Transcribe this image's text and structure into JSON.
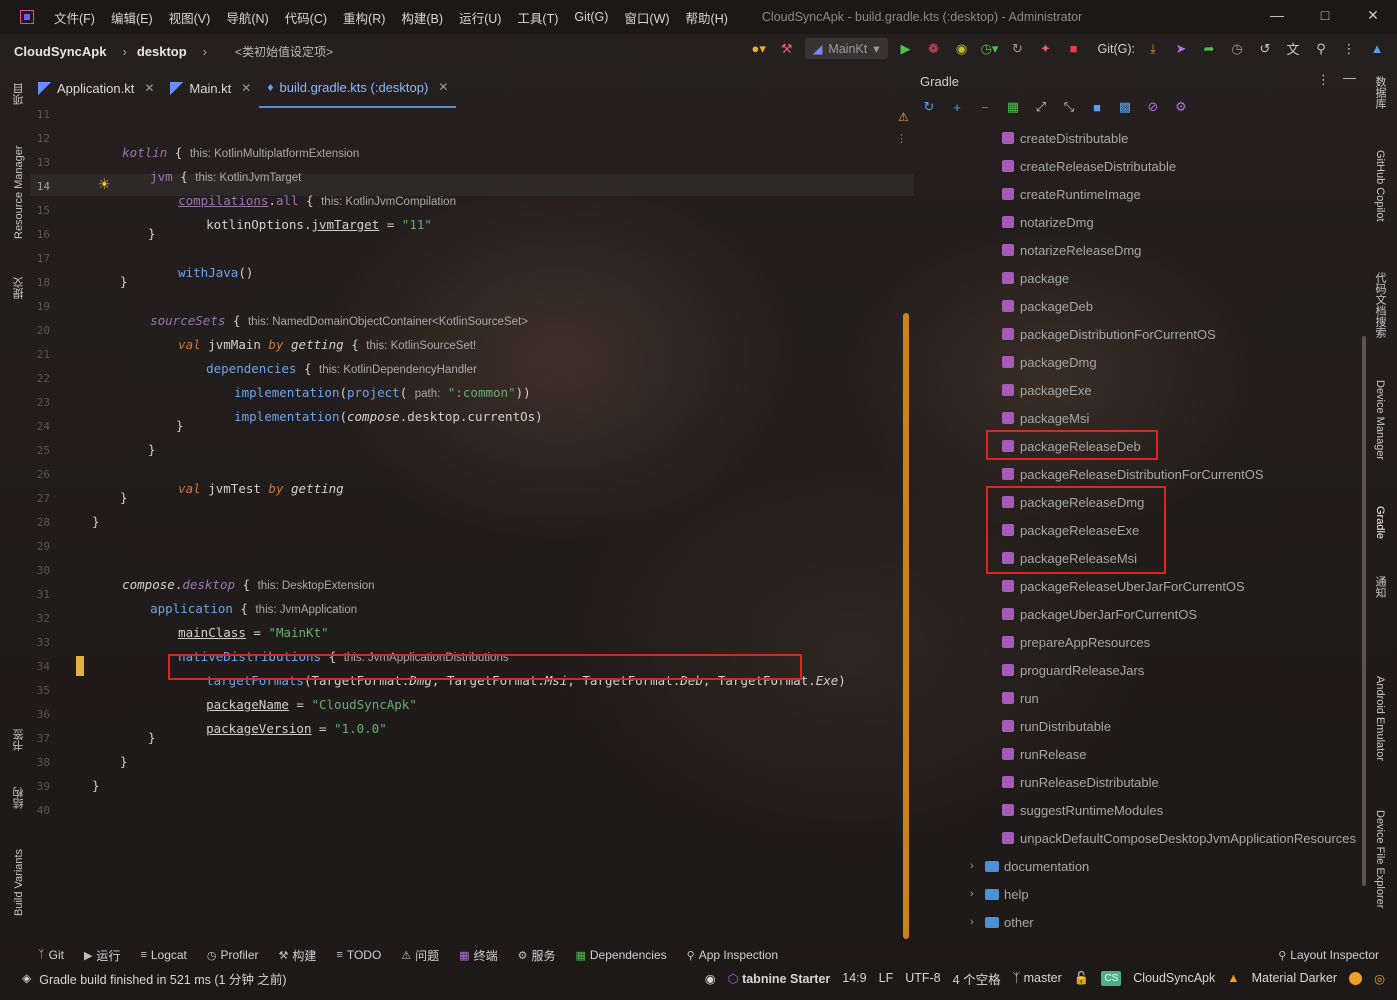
{
  "window": {
    "menus": [
      "文件(F)",
      "编辑(E)",
      "视图(V)",
      "导航(N)",
      "代码(C)",
      "重构(R)",
      "构建(B)",
      "运行(U)",
      "工具(T)",
      "Git(G)",
      "窗口(W)",
      "帮助(H)"
    ],
    "title": "CloudSyncApk - build.gradle.kts (:desktop) - Administrator"
  },
  "navbar": {
    "project": "CloudSyncApk",
    "module": "desktop",
    "member": "<类初始值设定项>",
    "run_config": "MainKt",
    "git_label": "Git(G):"
  },
  "left_stripe": {
    "project": "项目",
    "resource_manager": "Resource Manager",
    "commit": "提交",
    "bookmarks": "书签",
    "structure": "结构",
    "build_variants": "Build Variants"
  },
  "tabs": [
    {
      "label": "Application.kt"
    },
    {
      "label": "Main.kt"
    },
    {
      "label": "build.gradle.kts (:desktop)"
    }
  ],
  "editor": {
    "line_numbers": [
      "11",
      "12",
      "13",
      "14",
      "15",
      "16",
      "17",
      "18",
      "19",
      "20",
      "21",
      "22",
      "23",
      "24",
      "25",
      "26",
      "27",
      "28",
      "29",
      "30",
      "31",
      "32",
      "33",
      "34",
      "35",
      "36",
      "37",
      "38",
      "39",
      "40"
    ],
    "hints": {
      "kotlin": "this: KotlinMultiplatformExtension",
      "jvm": "this: KotlinJvmTarget",
      "compilations": "this: KotlinJvmCompilation",
      "sourceSets": "this: NamedDomainObjectContainer<KotlinSourceSet>",
      "jvmMain": "this: KotlinSourceSet!",
      "dependencies": "this: KotlinDependencyHandler",
      "path": "path:",
      "compose": "this: DesktopExtension",
      "application": "this: JvmApplication",
      "nativeDistributions": "this: JvmApplicationDistributions"
    },
    "strings": {
      "jvm_target": "\"11\"",
      "common": "\":common\"",
      "main_class": "\"MainKt\"",
      "package_name": "\"CloudSyncApk\"",
      "package_version": "\"1.0.0\""
    }
  },
  "gradle": {
    "title": "Gradle",
    "tasks": [
      "createDistributable",
      "createReleaseDistributable",
      "createRuntimeImage",
      "notarizeDmg",
      "notarizeReleaseDmg",
      "package",
      "packageDeb",
      "packageDistributionForCurrentOS",
      "packageDmg",
      "packageExe",
      "packageMsi",
      "packageReleaseDeb",
      "packageReleaseDistributionForCurrentOS",
      "packageReleaseDmg",
      "packageReleaseExe",
      "packageReleaseMsi",
      "packageReleaseUberJarForCurrentOS",
      "packageUberJarForCurrentOS",
      "prepareAppResources",
      "proguardReleaseJars",
      "run",
      "runDistributable",
      "runRelease",
      "runReleaseDistributable",
      "suggestRuntimeModules",
      "unpackDefaultComposeDesktopJvmApplicationResources"
    ],
    "groups": [
      "documentation",
      "help",
      "other"
    ]
  },
  "right_stripe": {
    "database": "数据库",
    "copilot": "GitHub Copilot",
    "code_search": "代码文档搜索",
    "device_manager": "Device Manager",
    "gradle": "Gradle",
    "notifications": "通知",
    "emulator": "Android Emulator",
    "file_explorer": "Device File Explorer"
  },
  "bottom_tools": [
    "Git",
    "运行",
    "Logcat",
    "Profiler",
    "构建",
    "TODO",
    "问题",
    "终端",
    "服务",
    "Dependencies",
    "App Inspection"
  ],
  "layout_inspector": "Layout Inspector",
  "status": {
    "message": "Gradle build finished in 521 ms (1 分钟 之前)",
    "tabnine": "tabnine Starter",
    "position": "14:9",
    "line_sep": "LF",
    "encoding": "UTF-8",
    "indent": "4 个空格",
    "branch": "master",
    "project_badge": "CS",
    "project": "CloudSyncApk",
    "theme": "Material Darker"
  },
  "colors": {
    "keyword": "#cc7832",
    "property": "#9876aa",
    "function": "#6fa3e8",
    "string": "#6aab73",
    "highlight_border": "#e02424",
    "task_icon": "#a65bb8"
  }
}
